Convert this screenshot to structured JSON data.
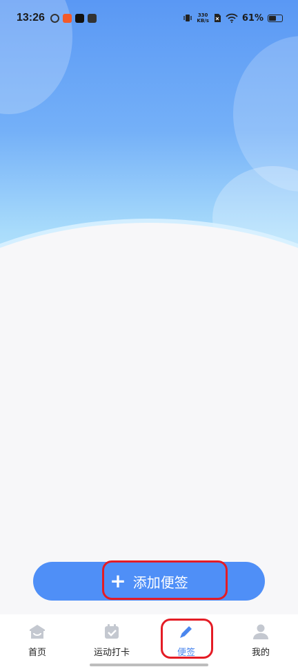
{
  "status_bar": {
    "time": "13:26",
    "network_speed_value": "330",
    "network_speed_unit": "KB/s",
    "battery_level": "61%",
    "battery_fraction": 0.61,
    "app_icons": [
      "weibo-icon",
      "xiaohongshu-icon",
      "tiktok-icon",
      "message-icon"
    ]
  },
  "main": {
    "add_button_plus": "+",
    "add_button_label": "添加便签"
  },
  "tabbar": {
    "tabs": [
      {
        "label": "首页",
        "icon": "home-icon"
      },
      {
        "label": "运动打卡",
        "icon": "calendar-check-icon"
      },
      {
        "label": "便签",
        "icon": "pencil-icon",
        "active": true
      },
      {
        "label": "我的",
        "icon": "user-icon"
      }
    ]
  },
  "colors": {
    "accent": "#4f8ff7",
    "active_tab": "#4a86ee",
    "inactive_tab_icon": "#c4c8d0",
    "annotation": "#e41c25",
    "hero_top": "#5a98f4",
    "hero_bottom": "#bfe8fc"
  }
}
